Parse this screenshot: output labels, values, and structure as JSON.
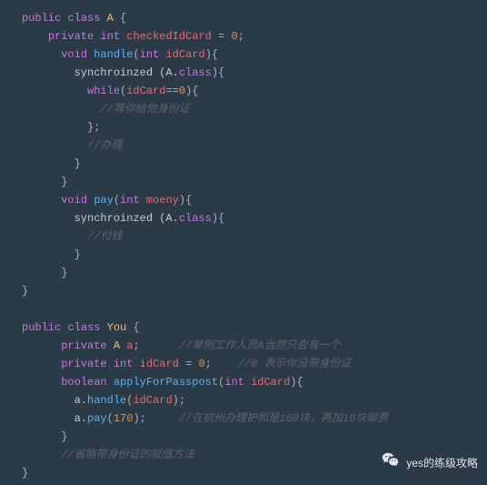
{
  "code": {
    "l1": {
      "kw_public": "public",
      "kw_class": "class",
      "cls": "A",
      "brace": " {"
    },
    "l2": {
      "kw_private": "private",
      "type": "int",
      "var": "checkedIdCard",
      "eq": " = ",
      "num": "0",
      "semi": ";"
    },
    "l3": {
      "kw_void": "void",
      "fn": "handle",
      "open": "(",
      "type": "int",
      "sp": " ",
      "var": "idCard",
      "close": "){"
    },
    "l4": {
      "text": "synchroinzed (A.",
      "cls": "class",
      "close": "){"
    },
    "l5": {
      "kw_while": "while",
      "open": "(",
      "var": "idCard",
      "eq": "==",
      "num": "0",
      "close": "){"
    },
    "l6": {
      "cmnt": "//等你给他身份证"
    },
    "l7": {
      "text": "};"
    },
    "l8": {
      "cmnt": "//办理"
    },
    "l9": {
      "text": "}"
    },
    "l10": {
      "text": "}"
    },
    "l11": {
      "kw_void": "void",
      "fn": "pay",
      "open": "(",
      "type": "int",
      "sp": " ",
      "var": "moeny",
      "close": "){"
    },
    "l12": {
      "text": "synchroinzed (A.",
      "cls": "class",
      "close": "){"
    },
    "l13": {
      "cmnt": "//付钱"
    },
    "l14": {
      "text": "}"
    },
    "l15": {
      "text": "}"
    },
    "l16": {
      "text": "}"
    },
    "l18": {
      "kw_public": "public",
      "kw_class": "class",
      "cls": "You",
      "brace": " {"
    },
    "l19": {
      "kw_private": "private",
      "cls": "A",
      "sp": " ",
      "var": "a",
      "semi": ";",
      "cmnt": "//单例工作人员A当然只会有一个"
    },
    "l20": {
      "kw_private": "private",
      "type": "int",
      "var": "idCard",
      "eq": " = ",
      "num": "0",
      "semi": ";",
      "cmnt": "//0 表示你没带身份证"
    },
    "l21": {
      "type": "boolean",
      "fn": "applyForPasspost",
      "open": "(",
      "ptype": "int",
      "sp": " ",
      "var": "idCard",
      "close": "){"
    },
    "l22": {
      "obj": "a.",
      "fn": "handle",
      "open": "(",
      "var": "idCard",
      "close": ");"
    },
    "l23": {
      "obj": "a.",
      "fn": "pay",
      "open": "(",
      "num": "170",
      "close": ");",
      "cmnt": "//在杭州办理护照是160块，再加10块邮费"
    },
    "l24": {
      "text": "}"
    },
    "l25": {
      "cmnt": "//省略带身份证的赋值方法"
    },
    "l26": {
      "text": "}"
    }
  },
  "watermark": {
    "text": "yes的练级攻略"
  }
}
